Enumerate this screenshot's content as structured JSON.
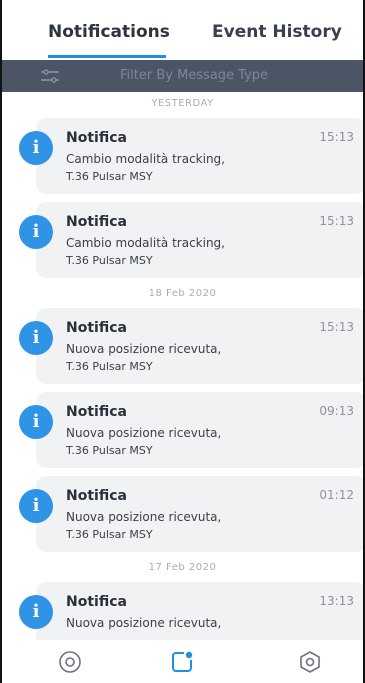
{
  "tabs": {
    "notifications": "Notifications",
    "event_history": "Event History",
    "active_color": "#1e90e8"
  },
  "filter": {
    "label": "Filter By Message Type",
    "icon": "filter-sliders-icon"
  },
  "groups": [
    {
      "date_label": "YESTERDAY",
      "items": [
        {
          "title": "Notifica",
          "time": "15:13",
          "line1": "Cambio modalità tracking,",
          "line2": "T.36 Pulsar MSY"
        },
        {
          "title": "Notifica",
          "time": "15:13",
          "line1": "Cambio modalità tracking,",
          "line2": "T.36 Pulsar MSY"
        }
      ]
    },
    {
      "date_label": "18 Feb 2020",
      "items": [
        {
          "title": "Notifica",
          "time": "15:13",
          "line1": "Nuova posizione ricevuta,",
          "line2": "T.36 Pulsar MSY"
        },
        {
          "title": "Notifica",
          "time": "09:13",
          "line1": "Nuova posizione ricevuta,",
          "line2": "T.36 Pulsar MSY"
        },
        {
          "title": "Notifica",
          "time": "01:12",
          "line1": "Nuova posizione ricevuta,",
          "line2": "T.36 Pulsar MSY"
        }
      ]
    },
    {
      "date_label": "17 Feb 2020",
      "items": [
        {
          "title": "Notifica",
          "time": "13:13",
          "line1": "Nuova posizione ricevuta,",
          "line2": ""
        }
      ]
    }
  ],
  "badge": {
    "glyph": "i",
    "icon": "info-icon",
    "color": "#2f93e6"
  },
  "bottom_nav": [
    {
      "icon": "target-circle-icon",
      "active": false
    },
    {
      "icon": "notifications-square-icon",
      "active": true
    },
    {
      "icon": "hexagon-settings-icon",
      "active": false
    }
  ]
}
